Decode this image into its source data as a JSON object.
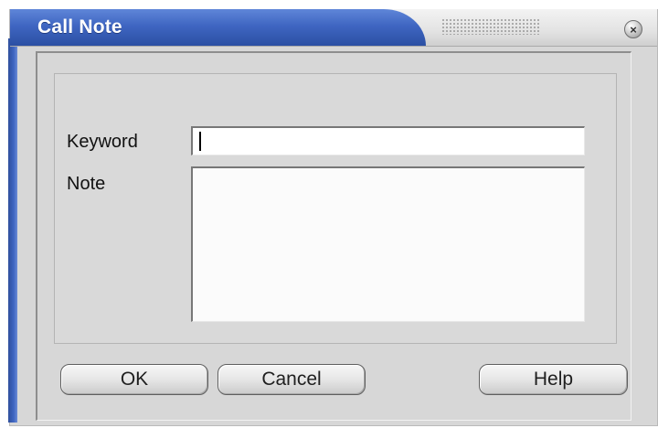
{
  "window": {
    "title": "Call Note",
    "close_symbol": "×"
  },
  "form": {
    "keyword_label": "Keyword",
    "keyword_value": "",
    "note_label": "Note",
    "note_value": ""
  },
  "buttons": {
    "ok_label": "OK",
    "cancel_label": "Cancel",
    "help_label": "Help"
  },
  "icons": {
    "close": "close-icon",
    "grip": "grip-icon"
  }
}
